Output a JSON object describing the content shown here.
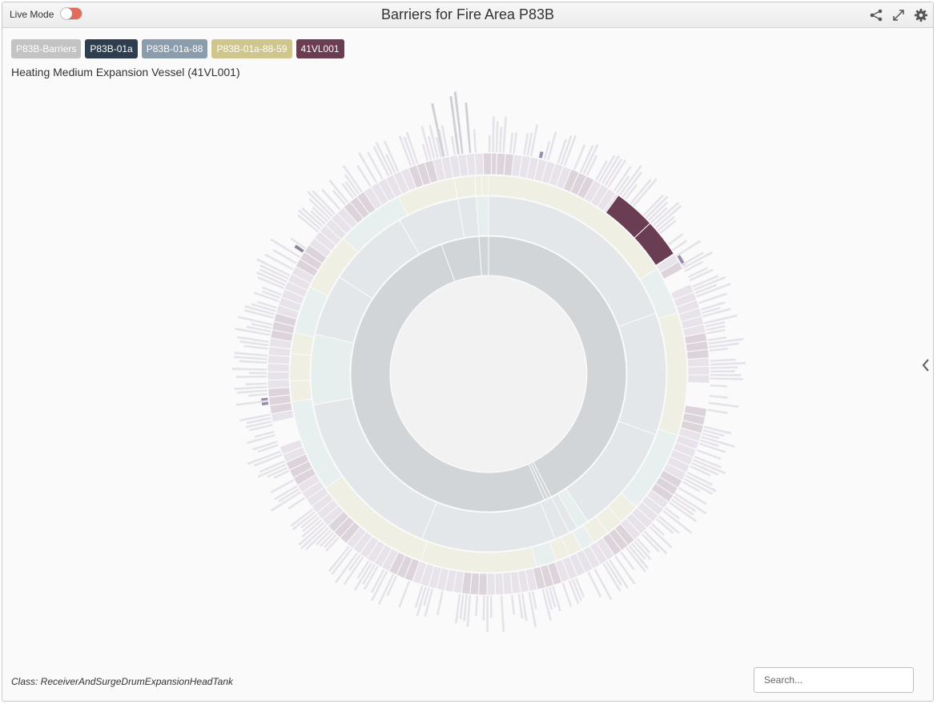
{
  "header": {
    "live_mode_label": "Live Mode",
    "live_mode_on": false,
    "title": "Barriers for Fire Area P83B",
    "icons": [
      "share-icon",
      "expand-icon",
      "gear-icon"
    ]
  },
  "breadcrumb": [
    {
      "label": "P83B-Barriers",
      "color": "#c3c3c3"
    },
    {
      "label": "P83B-01a",
      "color": "#2f3e4e"
    },
    {
      "label": "P83B-01a-88",
      "color": "#8b9cad"
    },
    {
      "label": "P83B-01a-88-59",
      "color": "#cfc68d"
    },
    {
      "label": "41VL001",
      "color": "#6a3d52"
    }
  ],
  "selected_node_title": "Heating Medium Expansion Vessel (41VL001)",
  "class_text": "Class: ReceiverAndSurgeDrumExpansionHeadTank",
  "search": {
    "placeholder": "Search...",
    "value": ""
  },
  "colors": {
    "ring1": "#d2d5d8",
    "ring2": "#e3e7ea",
    "ring2_alt": "#e6eeee",
    "ring3": "#efefe4",
    "ring3_alt": "#e8f0ef",
    "ring4": "#e8e3ea",
    "ring4_alt": "#ddd3da",
    "highlight": "#6a3d52",
    "accent_purple": "#9a88b0",
    "outer_fringe": "#e6e2ea"
  }
}
